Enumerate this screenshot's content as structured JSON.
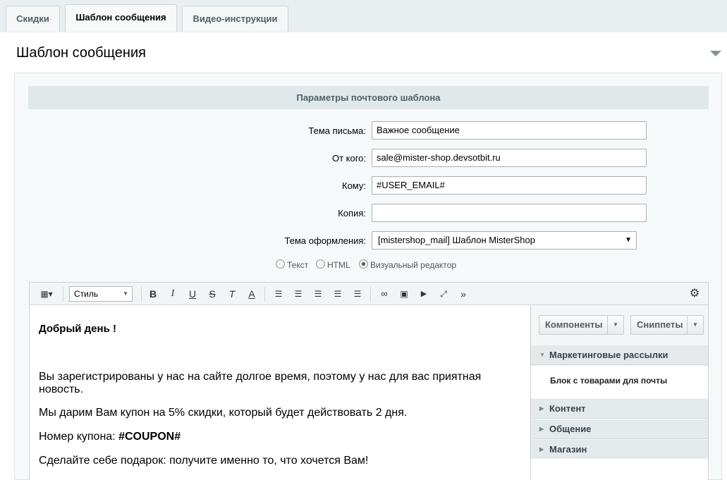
{
  "tabs": [
    {
      "label": "Скидки",
      "active": false
    },
    {
      "label": "Шаблон сообщения",
      "active": true
    },
    {
      "label": "Видео-инструкции",
      "active": false
    }
  ],
  "panel": {
    "title": "Шаблон сообщения"
  },
  "section": {
    "title": "Параметры почтового шаблона"
  },
  "form": {
    "subject": {
      "label": "Тема письма:",
      "value": "Важное сообщение"
    },
    "from": {
      "label": "От кого:",
      "value": "sale@mister-shop.devsotbit.ru"
    },
    "to": {
      "label": "Кому:",
      "value": "#USER_EMAIL#"
    },
    "copy": {
      "label": "Копия:",
      "value": ""
    },
    "theme": {
      "label": "Тема оформления:",
      "value": "[mistershop_mail] Шаблон MisterShop"
    }
  },
  "mode": {
    "options": [
      "Текст",
      "HTML",
      "Визуальный редактор"
    ],
    "selected": "Визуальный редактор"
  },
  "toolbar": {
    "style_label": "Стиль"
  },
  "editor": {
    "greeting": "Добрый день !",
    "line1": "Вы зарегистрированы у нас на сайте долгое время, поэтому у нас для вас приятная",
    "line1b": "новость.",
    "line2": "Мы дарим Вам купон на 5% скидки, который будет действовать 2 дня.",
    "coupon_prefix": "Номер купона: ",
    "coupon_code": "#COUPON#",
    "line4": "Сделайте себе подарок: получите именно то, что хочется Вам!"
  },
  "sidebar": {
    "components_label": "Компоненты",
    "snippets_label": "Сниппеты",
    "groups": [
      {
        "label": "Маркетинговые рассылки",
        "expanded": true,
        "items": [
          "Блок с товарами для почты"
        ]
      },
      {
        "label": "Контент",
        "expanded": false
      },
      {
        "label": "Общение",
        "expanded": false
      },
      {
        "label": "Магазин",
        "expanded": false
      }
    ]
  }
}
